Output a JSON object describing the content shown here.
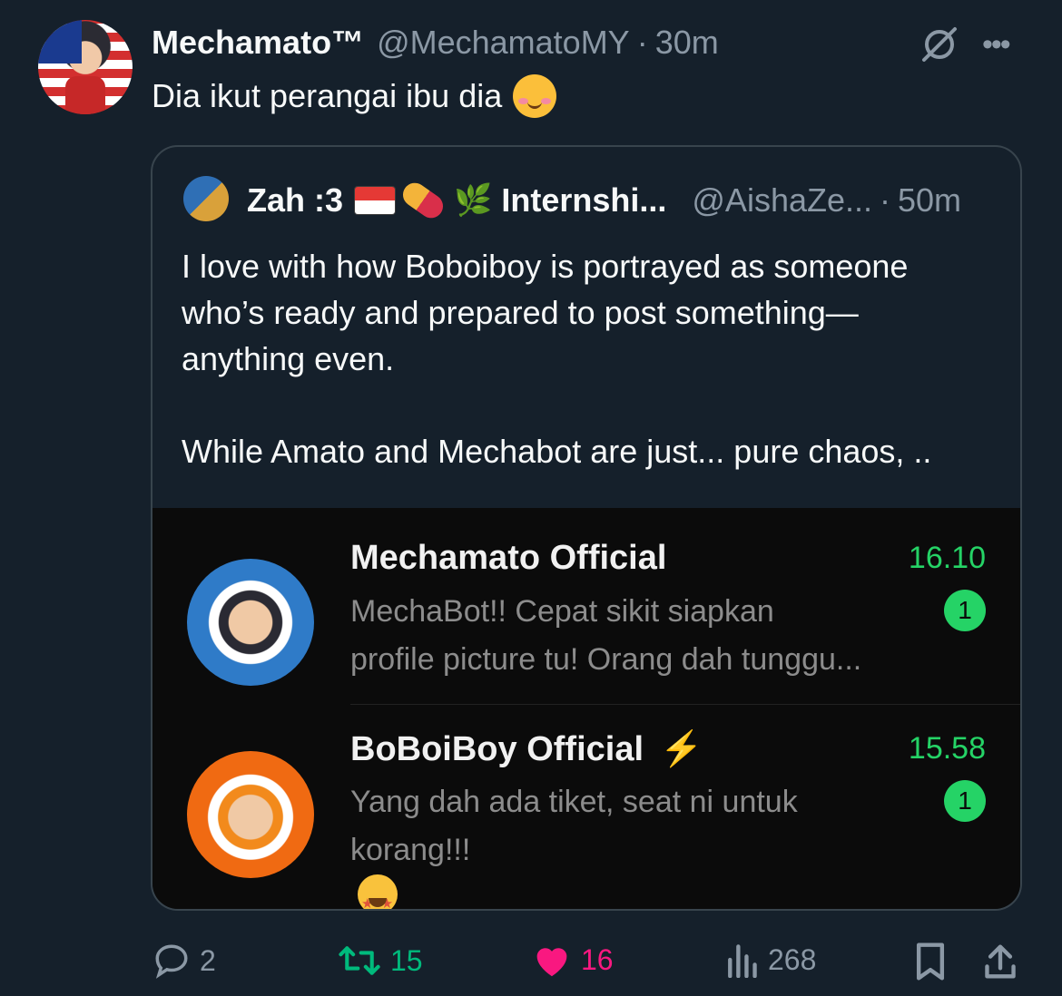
{
  "tweet": {
    "display_name": "Mechamato™",
    "handle": "@MechamatoMY",
    "separator": "·",
    "time": "30m",
    "text": "Dia ikut perangai ibu dia"
  },
  "quoted": {
    "name": "Zah :3",
    "name_suffix": "Internshi...",
    "handle": "@AishaZe...",
    "separator": "·",
    "time": "50m",
    "lines": [
      "I love with how Boboiboy is portrayed as someone",
      "who’s ready and prepared to post something—",
      "anything even.",
      "",
      "While Amato and Mechabot are just... pure chaos, .."
    ]
  },
  "chats": [
    {
      "name": "Mechamato Official",
      "time": "16.10",
      "msg_line1": "MechaBot!! Cepat sikit siapkan",
      "msg_line2": "profile picture tu! Orang dah tunggu...",
      "unread": "1"
    },
    {
      "name": "BoBoiBoy Official",
      "time": "15.58",
      "msg_line1": "Yang dah ada tiket, seat ni untuk",
      "msg_line2": "korang!!!",
      "unread": "1",
      "bolt": "⚡"
    }
  ],
  "actions": {
    "replies": "2",
    "retweets": "15",
    "likes": "16",
    "views": "268"
  },
  "colors": {
    "background": "#15202b",
    "secondary_text": "#8b98a5",
    "retweet_green": "#00ba7c",
    "like_pink": "#f91880",
    "whatsapp_green": "#25d366"
  },
  "icons": [
    "grok-icon",
    "more-icon",
    "reply-icon",
    "retweet-icon",
    "heart-icon",
    "views-icon",
    "bookmark-icon",
    "share-icon"
  ]
}
